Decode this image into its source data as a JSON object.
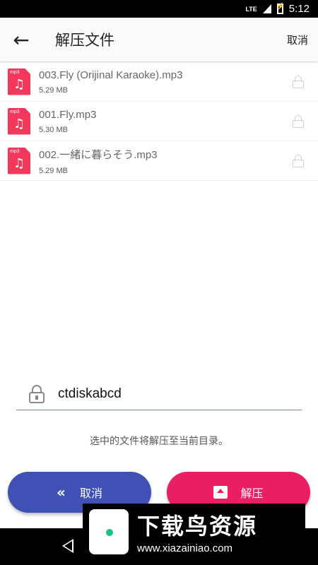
{
  "status_bar": {
    "network": "LTE",
    "time": "5:12"
  },
  "toolbar": {
    "title": "解压文件",
    "cancel_label": "取消"
  },
  "files": [
    {
      "name": "003.Fly (Orijinal Karaoke).mp3",
      "size": "5.29 MB",
      "ext": "mp3"
    },
    {
      "name": "001.Fly.mp3",
      "size": "5.30 MB",
      "ext": "mp3"
    },
    {
      "name": "002.一緒に暮らそう.mp3",
      "size": "5.29 MB",
      "ext": "mp3"
    }
  ],
  "password": {
    "value": "ctdiskabcd"
  },
  "hint": "选中的文件将解压至当前目录。",
  "buttons": {
    "cancel_label": "取消",
    "extract_label": "解压"
  },
  "watermark": {
    "brand": "下载鸟资源",
    "url": "www.xiazainiao.com"
  }
}
